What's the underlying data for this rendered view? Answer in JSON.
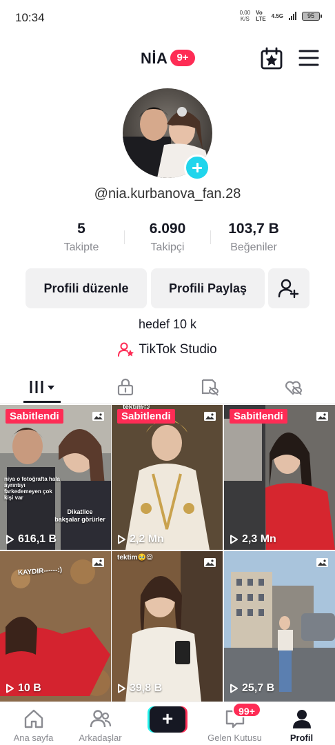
{
  "status_bar": {
    "time": "10:34",
    "net_speed_value": "0,00",
    "net_speed_unit": "K/S",
    "net_type_top": "Vo",
    "net_type_bottom": "LTE",
    "net_gen": "4.5G",
    "battery": "95"
  },
  "header": {
    "title": "NİA",
    "badge": "9+"
  },
  "profile": {
    "handle": "@nia.kurbanova_fan.28",
    "stats": [
      {
        "value": "5",
        "label": "Takipte"
      },
      {
        "value": "6.090",
        "label": "Takipçi"
      },
      {
        "value": "103,7 B",
        "label": "Beğeniler"
      }
    ],
    "edit_button": "Profili düzenle",
    "share_button": "Profili Paylaş",
    "bio": "hedef 10 k",
    "studio_link": "TikTok Studio"
  },
  "tabs": [
    {
      "icon": "videos-grid-icon",
      "active": true
    },
    {
      "icon": "private-lock-icon",
      "active": false
    },
    {
      "icon": "reposts-icon",
      "active": false
    },
    {
      "icon": "liked-hidden-icon",
      "active": false
    }
  ],
  "grid": {
    "pinned_label": "Sabitlendi",
    "tiles": [
      {
        "views": "616,1 B",
        "pinned": true,
        "caption_1": "niya o fotoğrafta hala ayrıntıyı farkedemeyen çok kişi var",
        "caption_2": "Dikatlice bakşalar görürler"
      },
      {
        "views": "2,2 Mn",
        "pinned": true,
        "caption_1": "tektim😋"
      },
      {
        "views": "2,3 Mn",
        "pinned": true
      },
      {
        "views": "10 B",
        "pinned": false,
        "caption_1": "KAYDIR------:)"
      },
      {
        "views": "39,8 B",
        "pinned": false,
        "caption_1": "tektim🥹😌"
      },
      {
        "views": "25,7 B",
        "pinned": false
      }
    ]
  },
  "bottom_nav": {
    "items": [
      {
        "label": "Ana sayfa",
        "icon": "home-icon"
      },
      {
        "label": "Arkadaşlar",
        "icon": "friends-icon"
      },
      {
        "label": "+",
        "icon": "create-plus-icon"
      },
      {
        "label": "Gelen Kutusu",
        "icon": "inbox-icon"
      },
      {
        "label": "Profil",
        "icon": "profile-icon"
      }
    ],
    "inbox_badge": "99+"
  },
  "colors": {
    "accent": "#fe2c55",
    "cyan": "#25f4ee",
    "text": "#161823",
    "muted": "#8a8b91",
    "button_bg": "#f1f1f2"
  }
}
